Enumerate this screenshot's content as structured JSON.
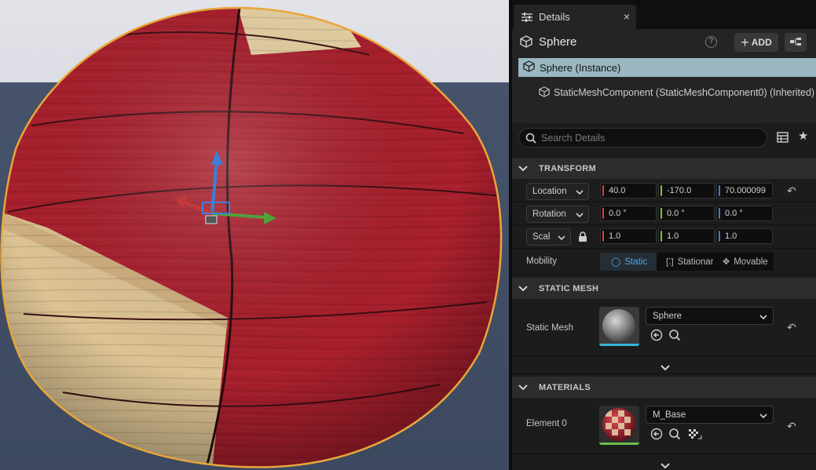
{
  "tab": {
    "label": "Details",
    "close": "×"
  },
  "actor": {
    "name": "Sphere",
    "help": "?",
    "add_label": "ADD"
  },
  "components": {
    "selected": "Sphere (Instance)",
    "child": "StaticMeshComponent (StaticMeshComponent0) (Inherited)"
  },
  "search": {
    "placeholder": "Search Details"
  },
  "transform": {
    "title": "TRANSFORM",
    "location": {
      "label": "Location",
      "x": "40.0",
      "y": "-170.0",
      "z": "70.000099"
    },
    "rotation": {
      "label": "Rotation",
      "x": "0.0 °",
      "y": "0.0 °",
      "z": "0.0 °"
    },
    "scale": {
      "label": "Scal",
      "x": "1.0",
      "y": "1.0",
      "z": "1.0"
    },
    "mobility": {
      "label": "Mobility",
      "options": [
        "Static",
        "Stationary",
        "Movable"
      ],
      "selected": "Static"
    }
  },
  "static_mesh": {
    "title": "STATIC MESH",
    "label": "Static Mesh",
    "value": "Sphere"
  },
  "materials": {
    "title": "MATERIALS",
    "label": "Element 0",
    "value": "M_Base"
  },
  "colors": {
    "x_axis": "#d9413f",
    "y_axis": "#7cc43f",
    "z_axis": "#3d7ed8",
    "selection": "#9ab7c2",
    "mesh_accent": "#33b4d6",
    "material_accent": "#6abf4b",
    "static_active": "#4ca7e6"
  },
  "icons": [
    "details-icon",
    "close-icon",
    "actor-cube-icon",
    "help-icon",
    "plus-icon",
    "blueprint-icon",
    "search-icon",
    "table-view-icon",
    "star-icon",
    "chevron-down-icon",
    "lock-icon",
    "reset-arrow-icon",
    "browse-arrow-icon",
    "find-icon",
    "checker-icon"
  ]
}
